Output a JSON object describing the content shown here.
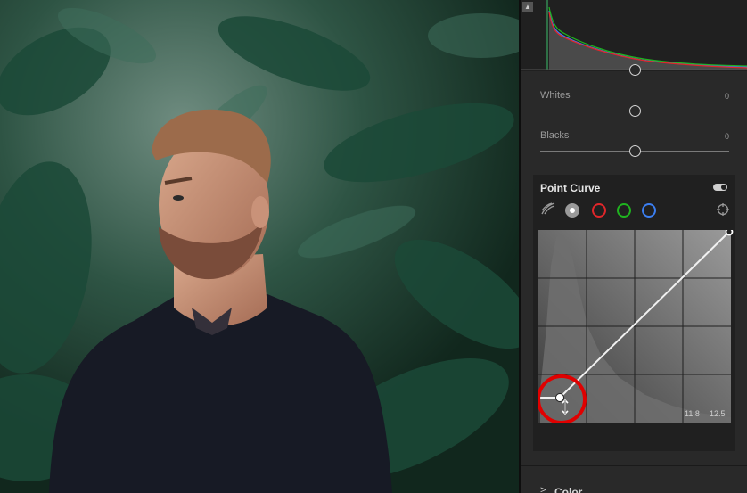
{
  "panel": {
    "collapse_glyph": "▲",
    "whites": {
      "label": "Whites",
      "value": "0",
      "level": 0.5
    },
    "blacks": {
      "label": "Blacks",
      "value": "0",
      "level": 0.5
    },
    "point_curve": {
      "title": "Point Curve",
      "channels": [
        "point-curve-mode-icon",
        "luminance",
        "red",
        "green",
        "blue"
      ],
      "channel_colors": {
        "red": "#e0262a",
        "green": "#1fb31f",
        "blue": "#3b7ef0"
      },
      "readout_left": "11.8",
      "readout_right": "12.5"
    },
    "color_section": {
      "chevron": ">",
      "label": "Color"
    }
  },
  "annotation": {
    "highlight_color": "#e00000"
  }
}
